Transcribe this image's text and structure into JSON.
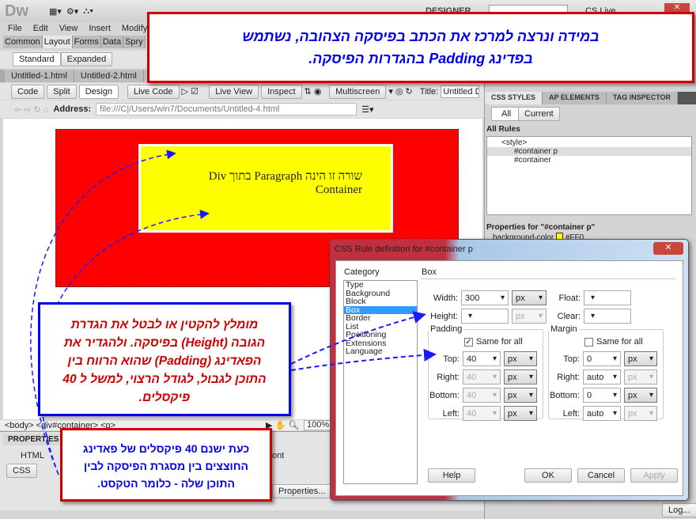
{
  "app": {
    "logo": "Dw",
    "workspace": "DESIGNER",
    "cs_live": "CS Live"
  },
  "menu": [
    "File",
    "Edit",
    "View",
    "Insert",
    "Modify"
  ],
  "insert_tabs": [
    "Common",
    "Layout",
    "Forms",
    "Data",
    "Spry"
  ],
  "layout_modes": [
    "Standard",
    "Expanded"
  ],
  "doc_tabs": [
    "Untitled-1.html",
    "Untitled-2.html",
    "Ur"
  ],
  "view_buttons": [
    "Code",
    "Split",
    "Design",
    "Live Code",
    "Live View",
    "Inspect",
    "Multiscreen"
  ],
  "title_label": "Title:",
  "title_value": "Untitled Doc",
  "address_label": "Address:",
  "address_value": "file:///C|/Users/win7/Documents/Untitled-4.html",
  "design": {
    "paragraph_text": "שורה זו הינה Paragraph בתוך Div Container",
    "container_color": "#FF0000",
    "paragraph_color": "#FFFF00"
  },
  "status": {
    "tag_path": "<body> <div#container> <p>",
    "zoom": "100%"
  },
  "properties": {
    "title": "PROPERTIES",
    "html": "HTML",
    "css": "CSS",
    "font_fragment": "ont",
    "page_properties": "Properties..."
  },
  "css_panel": {
    "tabs": [
      "CSS STYLES",
      "AP ELEMENTS",
      "TAG INSPECTOR"
    ],
    "all": "All",
    "current": "Current",
    "all_rules": "All Rules",
    "tree": [
      "<style>",
      "#container p",
      "#container"
    ],
    "props_for": "Properties for \"#container p\"",
    "prop_name": "background-color",
    "prop_value": "#FF0",
    "log": "Log..."
  },
  "dialog": {
    "title": "CSS Rule definition for #container p",
    "category_label": "Category",
    "categories": [
      "Type",
      "Background",
      "Block",
      "Box",
      "Border",
      "List",
      "Positioning",
      "Extensions",
      "Language"
    ],
    "selected": "Box",
    "section": "Box",
    "width_label": "Width:",
    "width": "300",
    "width_unit": "px",
    "height_label": "Height:",
    "height": "",
    "height_unit": "px",
    "float_label": "Float:",
    "clear_label": "Clear:",
    "padding": {
      "legend": "Padding",
      "same_for_all": "Same for all",
      "same_checked": true,
      "labels": [
        "Top:",
        "Right:",
        "Bottom:",
        "Left:"
      ],
      "values": [
        "40",
        "40",
        "40",
        "40"
      ],
      "units": [
        "px",
        "px",
        "px",
        "px"
      ]
    },
    "margin": {
      "legend": "Margin",
      "same_for_all": "Same for all",
      "same_checked": false,
      "labels": [
        "Top:",
        "Right:",
        "Bottom:",
        "Left:"
      ],
      "values": [
        "0",
        "auto",
        "0",
        "auto"
      ],
      "units": [
        "px",
        "px",
        "px",
        "px"
      ]
    },
    "buttons": {
      "help": "Help",
      "ok": "OK",
      "cancel": "Cancel",
      "apply": "Apply"
    }
  },
  "callouts": {
    "top": "במידה ונרצה למרכז את הכתב בפיסקה הצהובה, נשתמש בפדינג Padding בהגדרות הפיסקה.",
    "left": "מומלץ להקטין או לבטל את הגדרת הגובה (Height) בפיסקה. ולהגדיר את הפאדינג (Padding) שהוא הרווח בין התוכן לגבול, לגודל הרצוי, למשל ל 40 פיקסלים.",
    "bottom": "כעת ישנם 40 פיקסלים של פאדינג החוצצים בין מסגרת הפיסקה לבין התוכן שלה - כלומר הטקסט."
  },
  "colors": {
    "callout_red": "#CC0000",
    "callout_blue": "#0000EE",
    "arrow": "#1a1aff",
    "selection": "#3399ff"
  }
}
